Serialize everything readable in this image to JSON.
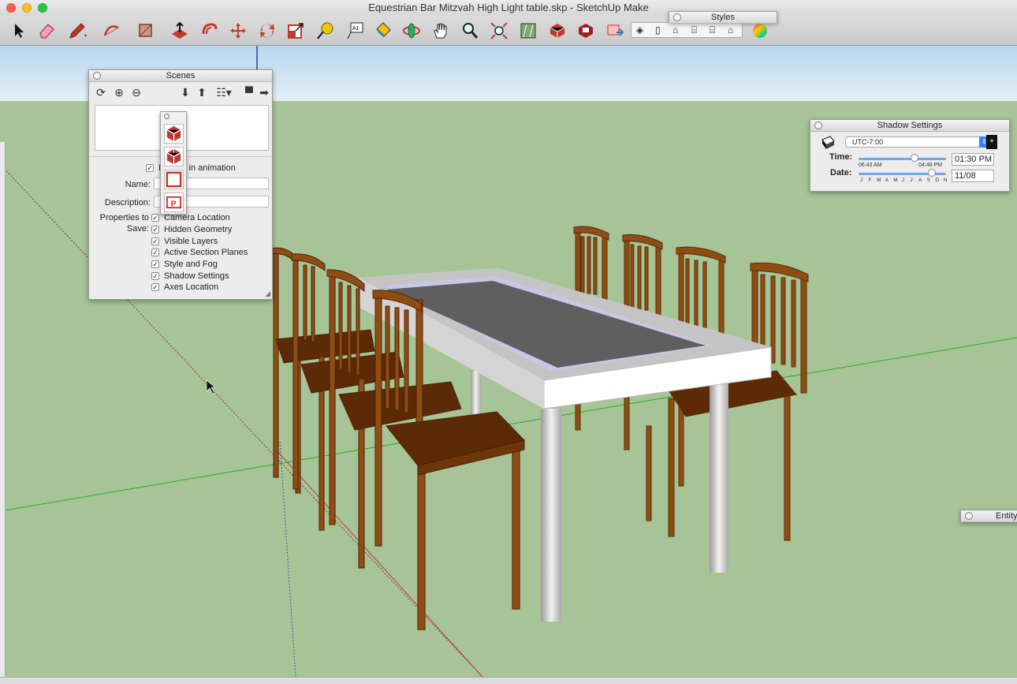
{
  "window": {
    "title": "Equestrian Bar Mitzvah High Light table.skp - SketchUp Make"
  },
  "toolbar": {
    "tools": [
      {
        "name": "select-tool-icon"
      },
      {
        "name": "eraser-tool-icon"
      },
      {
        "name": "pencil-line-tool-icon"
      },
      {
        "name": "arc-tool-icon"
      },
      {
        "name": "rectangle-tool-icon"
      },
      {
        "name": "push-pull-tool-icon"
      },
      {
        "name": "offset-tool-icon"
      },
      {
        "name": "move-tool-icon"
      },
      {
        "name": "rotate-tool-icon"
      },
      {
        "name": "scale-tool-icon"
      },
      {
        "name": "tape-measure-tool-icon"
      },
      {
        "name": "text-tool-icon"
      },
      {
        "name": "paint-bucket-tool-icon"
      },
      {
        "name": "orbit-tool-icon"
      },
      {
        "name": "pan-tool-icon"
      },
      {
        "name": "zoom-tool-icon"
      },
      {
        "name": "zoom-extents-tool-icon"
      },
      {
        "name": "add-location-icon"
      },
      {
        "name": "3d-warehouse-icon"
      },
      {
        "name": "extension-warehouse-icon"
      },
      {
        "name": "layout-icon"
      }
    ]
  },
  "styles_panel": {
    "title": "Styles"
  },
  "scenes_panel": {
    "title": "Scenes",
    "include_in_animation_label": "Include in animation",
    "name_label": "Name:",
    "description_label": "Description:",
    "properties_label": "Properties to",
    "save_label": "Save:",
    "properties": [
      {
        "label": "Camera Location",
        "checked": true
      },
      {
        "label": "Hidden Geometry",
        "checked": true
      },
      {
        "label": "Visible Layers",
        "checked": true
      },
      {
        "label": "Active Section Planes",
        "checked": true
      },
      {
        "label": "Style and Fog",
        "checked": true
      },
      {
        "label": "Shadow Settings",
        "checked": true
      },
      {
        "label": "Axes Location",
        "checked": true
      }
    ]
  },
  "shadow_panel": {
    "title": "Shadow Settings",
    "timezone": "UTC-7:00",
    "time_label": "Time:",
    "date_label": "Date:",
    "sunrise": "06:43 AM",
    "sunset": "04:48 PM",
    "time_value": "01:30 PM",
    "date_value": "11/08",
    "months": [
      "J",
      "F",
      "M",
      "A",
      "M",
      "J",
      "J",
      "A",
      "S",
      "O",
      "N",
      "D"
    ],
    "time_position": 0.64,
    "date_position": 0.84
  },
  "entity_panel": {
    "title": "Entity"
  },
  "colors": {
    "sky": "#dcebf7",
    "ground": "#a7c497",
    "wood": "#8a4a12",
    "table_top": "#5f5f5f",
    "table_frame": "#d9d9d9"
  }
}
